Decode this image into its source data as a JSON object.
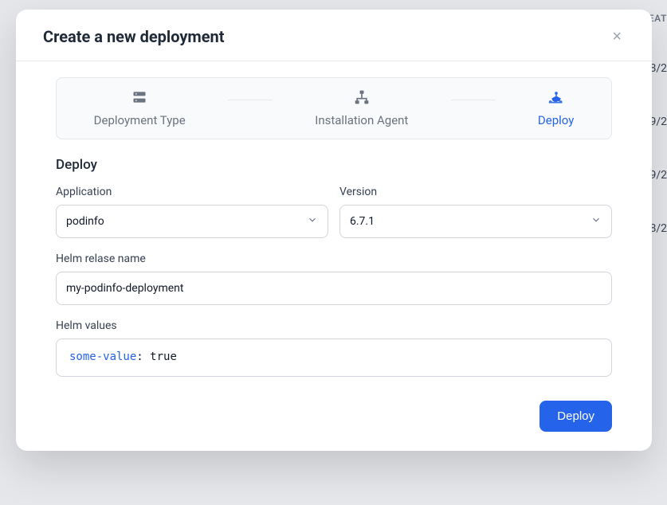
{
  "background": {
    "header_fragment": "EAT",
    "rows": [
      "8/2",
      "9/2",
      "9/2",
      "8/2"
    ]
  },
  "modal": {
    "title": "Create a new deployment",
    "close_glyph": "×",
    "stepper": {
      "step1": "Deployment Type",
      "step2": "Installation Agent",
      "step3": "Deploy"
    },
    "section_title": "Deploy",
    "application": {
      "label": "Application",
      "value": "podinfo"
    },
    "version": {
      "label": "Version",
      "value": "6.7.1"
    },
    "release": {
      "label": "Helm relase name",
      "value": "my-podinfo-deployment"
    },
    "helm_values": {
      "label": "Helm values",
      "key": "some-value",
      "rest": ": true"
    },
    "submit_label": "Deploy"
  }
}
